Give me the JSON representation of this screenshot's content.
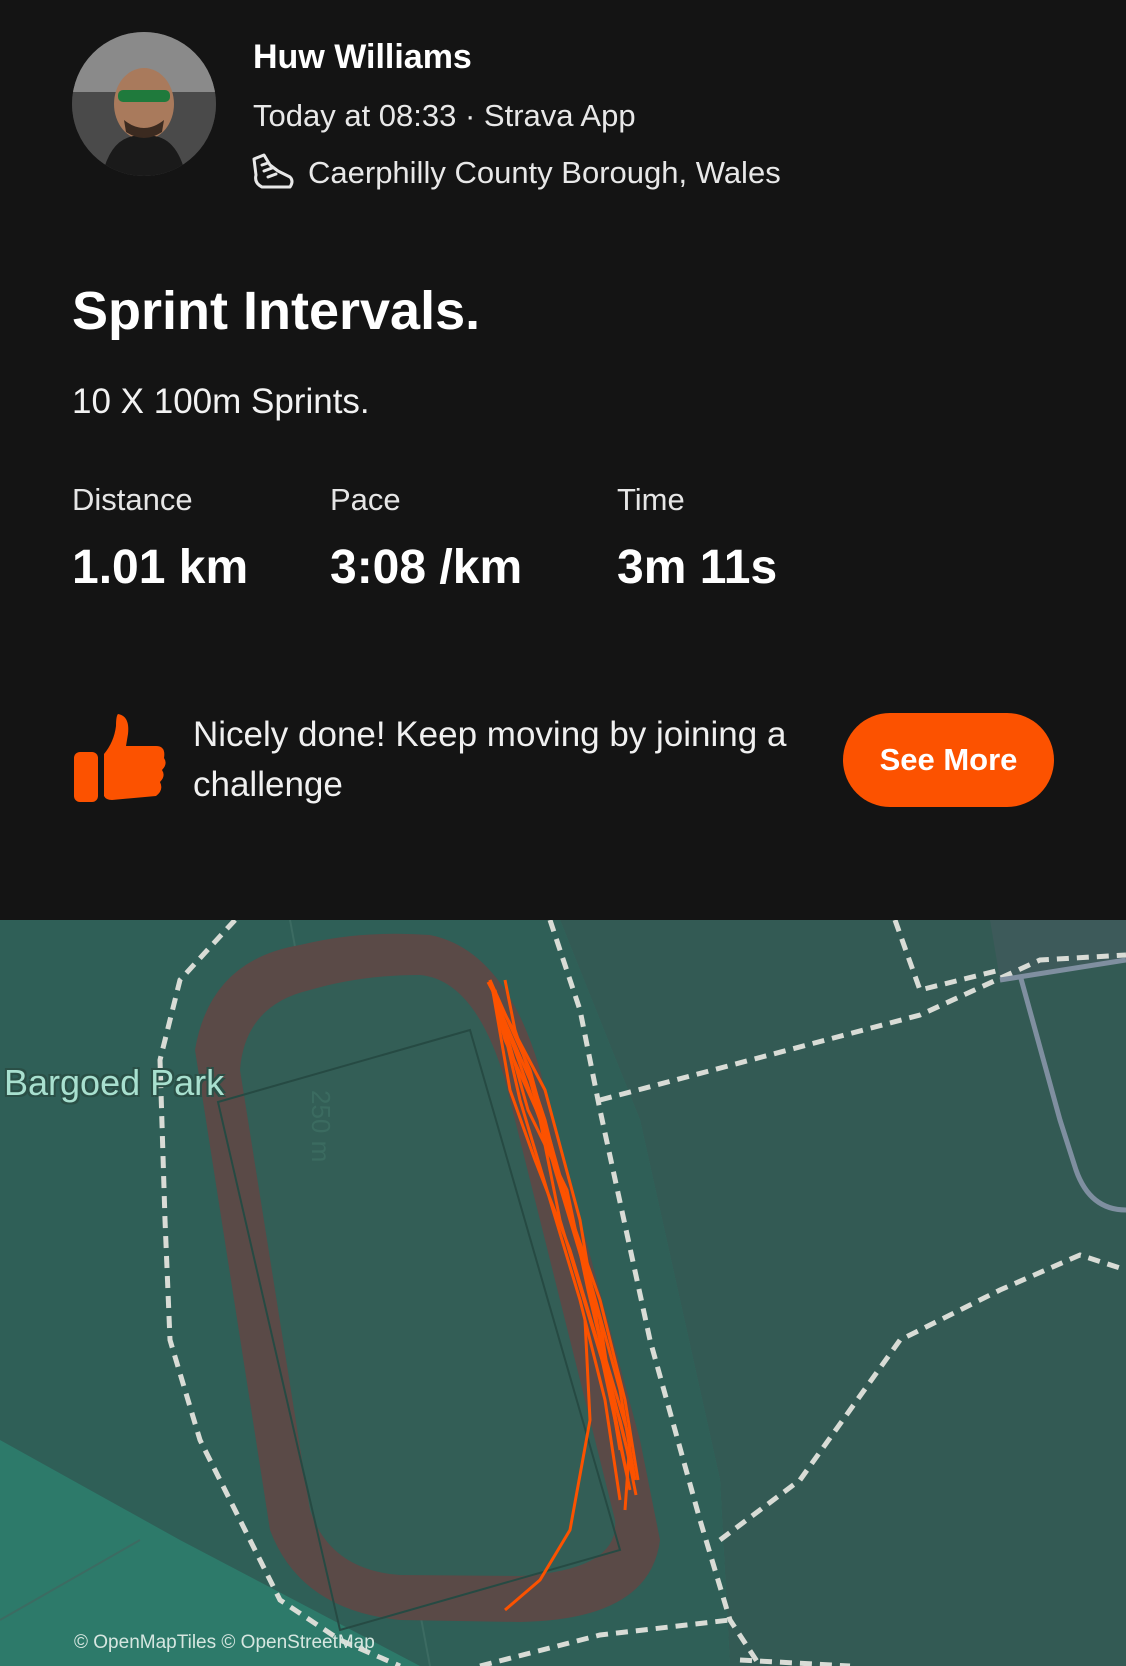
{
  "athlete": {
    "name": "Huw Williams",
    "meta": "Today at 08:33 · Strava App",
    "location": "Caerphilly County Borough, Wales"
  },
  "activity": {
    "title": "Sprint Intervals.",
    "description": "10 X 100m Sprints."
  },
  "stats": [
    {
      "label": "Distance",
      "value": "1.01 km"
    },
    {
      "label": "Pace",
      "value": "3:08 /km"
    },
    {
      "label": "Time",
      "value": "3m 11s"
    }
  ],
  "promo": {
    "text": "Nicely done! Keep moving by joining a challenge",
    "button_label": "See More"
  },
  "map": {
    "park_label": "Bargoed Park",
    "track_label": "250 m",
    "attribution": "© OpenMapTiles © OpenStreetMap"
  },
  "colors": {
    "accent": "#fc5200",
    "background": "#141414",
    "map_green": "#2d7a6a"
  },
  "icons": {
    "location": "shoe-icon",
    "promo": "thumbs-up-icon"
  }
}
